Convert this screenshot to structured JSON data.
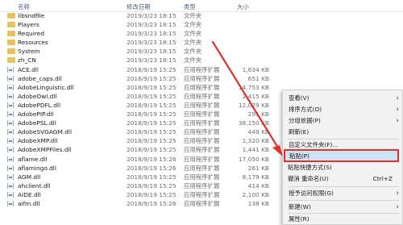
{
  "columns": {
    "name": "名称",
    "date": "修改日期",
    "type": "类型",
    "size": "大小"
  },
  "files": [
    {
      "name": "libsndfile",
      "date": "2019/3/23 18:15",
      "type": "文件夹",
      "size": "",
      "icon": "folder-icon"
    },
    {
      "name": "Players",
      "date": "2019/3/23 18:15",
      "type": "文件夹",
      "size": "",
      "icon": "folder-icon"
    },
    {
      "name": "Required",
      "date": "2019/3/23 18:15",
      "type": "文件夹",
      "size": "",
      "icon": "folder-icon"
    },
    {
      "name": "Resources",
      "date": "2019/3/23 18:15",
      "type": "文件夹",
      "size": "",
      "icon": "folder-icon"
    },
    {
      "name": "System",
      "date": "2019/3/23 18:15",
      "type": "文件夹",
      "size": "",
      "icon": "folder-icon"
    },
    {
      "name": "zh_CN",
      "date": "2019/3/23 18:15",
      "type": "文件夹",
      "size": "",
      "icon": "folder-icon"
    },
    {
      "name": "ACE.dll",
      "date": "2018/9/19 15:25",
      "type": "应用程序扩展",
      "size": "1,634 KB",
      "icon": "dll-file-icon"
    },
    {
      "name": "adobe_caps.dll",
      "date": "2018/9/19 15:25",
      "type": "应用程序扩展",
      "size": "651 KB",
      "icon": "dll-file-icon"
    },
    {
      "name": "AdobeLinguistic.dll",
      "date": "2018/9/19 15:25",
      "type": "应用程序扩展",
      "size": "14,753 KB",
      "icon": "dll-file-icon"
    },
    {
      "name": "AdobeOwl.dll",
      "date": "2018/9/19 15:25",
      "type": "应用程序扩展",
      "size": "2,415 KB",
      "icon": "dll-file-icon"
    },
    {
      "name": "AdobePDFL.dll",
      "date": "2018/9/19 15:25",
      "type": "应用程序扩展",
      "size": "12,079 KB",
      "icon": "dll-file-icon"
    },
    {
      "name": "AdobePIP.dll",
      "date": "2018/9/19 15:25",
      "type": "应用程序扩展",
      "size": "291 KB",
      "icon": "dll-file-icon"
    },
    {
      "name": "AdobePSL.dll",
      "date": "2018/9/19 15:25",
      "type": "应用程序扩展",
      "size": "38,150 KB",
      "icon": "dll-file-icon"
    },
    {
      "name": "AdobeSVGAGM.dll",
      "date": "2018/9/19 15:25",
      "type": "应用程序扩展",
      "size": "449 KB",
      "icon": "dll-file-icon"
    },
    {
      "name": "AdobeXMP.dll",
      "date": "2018/9/19 15:25",
      "type": "应用程序扩展",
      "size": "1,320 KB",
      "icon": "dll-file-icon"
    },
    {
      "name": "AdobeXMPFiles.dll",
      "date": "2018/9/19 15:25",
      "type": "应用程序扩展",
      "size": "1,441 KB",
      "icon": "dll-file-icon"
    },
    {
      "name": "aflame.dll",
      "date": "2018/9/19 15:26",
      "type": "应用程序扩展",
      "size": "17,050 KB",
      "icon": "dll-file-icon"
    },
    {
      "name": "aflamingo.dll",
      "date": "2018/9/19 15:26",
      "type": "应用程序扩展",
      "size": "261 KB",
      "icon": "dll-file-icon"
    },
    {
      "name": "AGM.dll",
      "date": "2018/9/19 15:25",
      "type": "应用程序扩展",
      "size": "8,179 KB",
      "icon": "dll-file-icon"
    },
    {
      "name": "ahclient.dll",
      "date": "2018/9/19 15:25",
      "type": "应用程序扩展",
      "size": "414 KB",
      "icon": "dll-file-icon"
    },
    {
      "name": "AIDE.dll",
      "date": "2018/9/19 15:25",
      "type": "应用程序扩展",
      "size": "2,100 KB",
      "icon": "dll-file-icon"
    },
    {
      "name": "aifm.dll",
      "date": "2018/9/19 15:26",
      "type": "应用程序扩展",
      "size": "138 KB",
      "icon": "dll-file-icon"
    }
  ],
  "context_menu": {
    "view": "查看(V)",
    "sort_by": "排序方式(O)",
    "group_by": "分组依据(P)",
    "refresh": "刷新(E)",
    "customize_folder": "自定义文件夹(F)...",
    "paste": "粘贴(P)",
    "paste_shortcut": "粘贴快捷方式(S)",
    "undo_rename": "撤消 重命名(U)",
    "undo_shortcut": "Ctrl+Z",
    "give_access": "授予访问权限(G)",
    "new": "新建(W)",
    "properties": "属性(R)"
  },
  "colors": {
    "highlight_border": "#e0322a",
    "arrow": "#e0322a",
    "folder": "#e8c25a"
  }
}
